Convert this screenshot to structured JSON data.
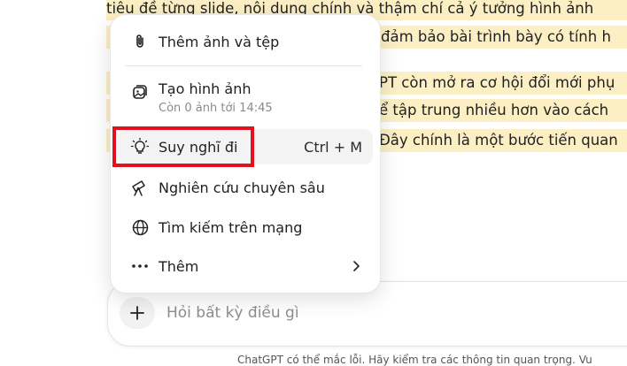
{
  "document": {
    "lines": [
      "tiêu đề từng slide, nội dung chính và thậm chí cả ý tưởng hình ảnh",
      "đảm bảo bài trình bày có tính h",
      "PT còn mở ra cơ hội đổi mới phụ",
      "ể tập trung nhiều hơn vào cách",
      "Đây chính là một bước tiến quan"
    ]
  },
  "menu": {
    "items": [
      {
        "label": "Thêm ảnh và tệp",
        "icon": "paperclip-icon"
      },
      {
        "label": "Tạo hình ảnh",
        "sub": "Còn 0 ảnh tới 14:45",
        "icon": "image-create-icon"
      },
      {
        "label": "Suy nghĩ đi",
        "shortcut": "Ctrl + M",
        "icon": "lightbulb-icon",
        "highlighted": true
      },
      {
        "label": "Nghiên cứu chuyên sâu",
        "icon": "telescope-icon"
      },
      {
        "label": "Tìm kiếm trên mạng",
        "icon": "globe-icon"
      },
      {
        "label": "Thêm",
        "icon": "more-dots-icon",
        "submenu": "chevron-right-icon"
      }
    ]
  },
  "composer": {
    "placeholder": "Hỏi bất kỳ điều gì",
    "plus_icon": "plus-icon"
  },
  "footer": {
    "note": "ChatGPT có thể mắc lỗi. Hãy kiểm tra các thông tin quan trọng. Vu"
  },
  "colors": {
    "highlight_bg": "#fcefc4",
    "annotation_red": "#e3101e",
    "menu_hover": "#f3f3f3"
  }
}
